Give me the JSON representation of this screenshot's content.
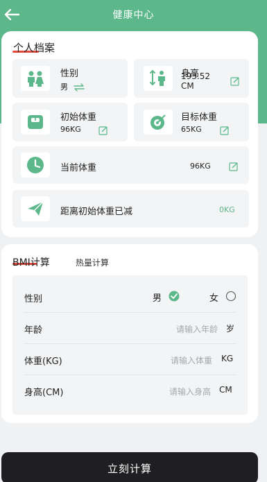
{
  "header": {
    "title": "健康中心"
  },
  "profile": {
    "title": "个人档案",
    "gender": {
      "label": "性别",
      "value": "男"
    },
    "height": {
      "label": "身高",
      "value": "193.52",
      "unit": "CM"
    },
    "initial_weight": {
      "label": "初始体重",
      "value": "96KG"
    },
    "target_weight": {
      "label": "目标体重",
      "value": "65KG"
    },
    "current_weight": {
      "label": "当前体重",
      "value": "96KG"
    },
    "lost": {
      "label": "距离初始体重已减",
      "value": "0KG"
    }
  },
  "bmi": {
    "tabs": [
      "BMI计算",
      "热量计算"
    ],
    "gender": {
      "label": "性别",
      "male": "男",
      "female": "女",
      "selected": "男"
    },
    "age": {
      "label": "年龄",
      "placeholder": "请输入年龄",
      "unit": "岁"
    },
    "weight": {
      "label": "体重(KG)",
      "placeholder": "请输入体重",
      "unit": "KG"
    },
    "height": {
      "label": "身高(CM)",
      "placeholder": "请输入身高",
      "unit": "CM"
    }
  },
  "submit_label": "立刻计算",
  "colors": {
    "accent": "#5cb88a",
    "underline": "#e04b3c",
    "button": "#1f1f21"
  },
  "icons": [
    "back-arrow-icon",
    "people-icon",
    "height-icon",
    "scale-icon",
    "target-icon",
    "clock-icon",
    "paper-plane-icon",
    "edit-icon",
    "swap-icon",
    "check-icon"
  ]
}
